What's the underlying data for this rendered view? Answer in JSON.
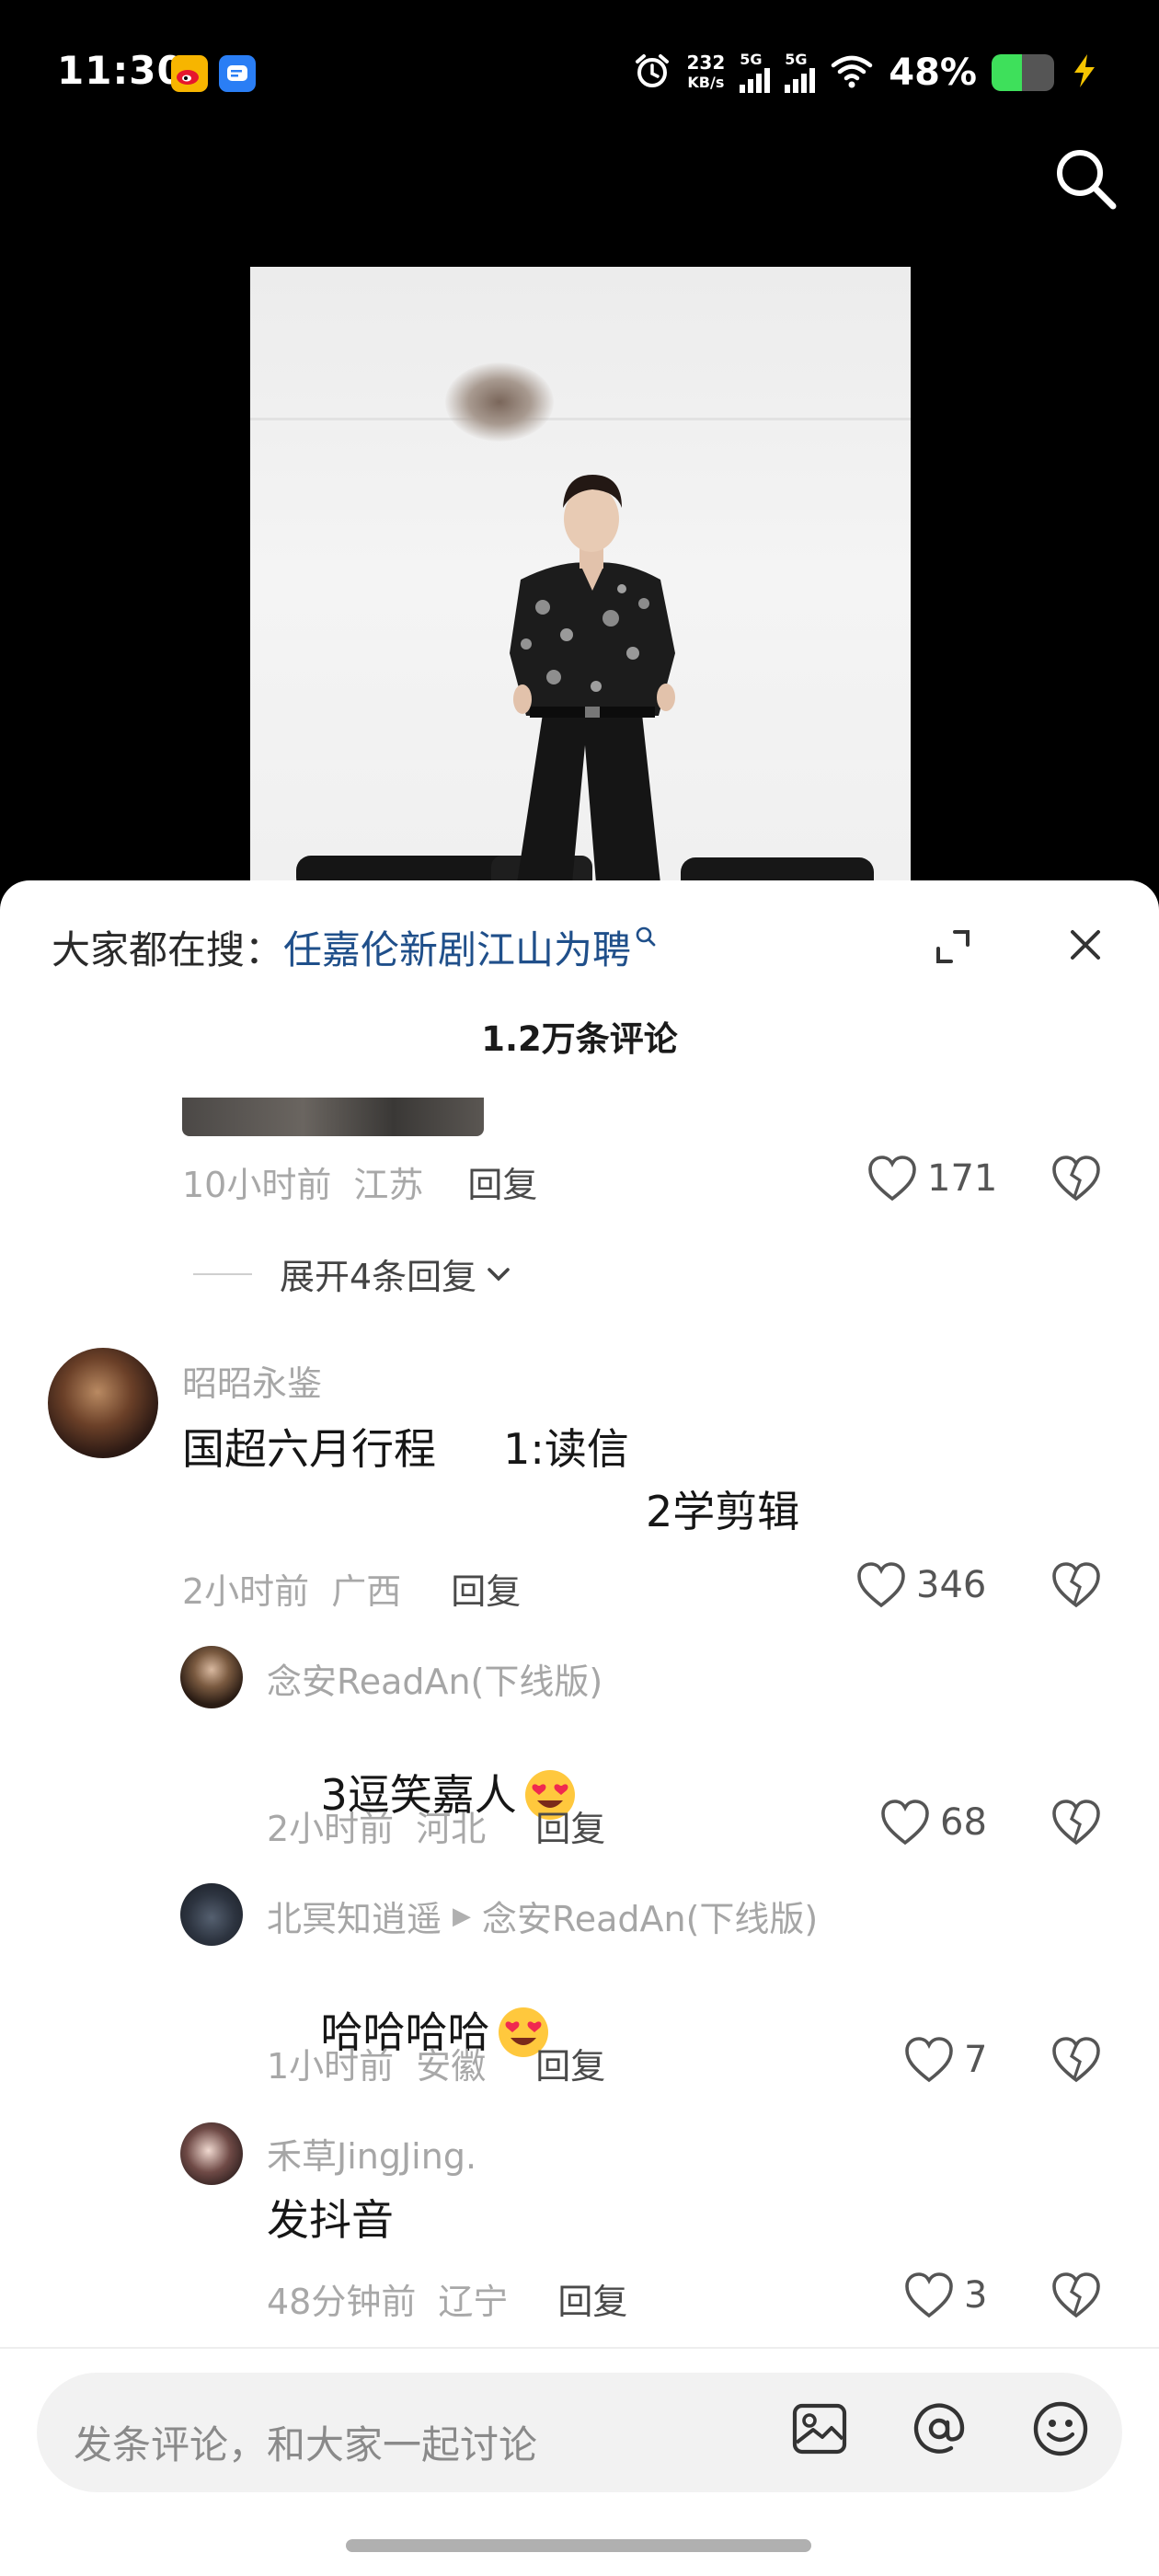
{
  "status_bar": {
    "time": "11:30",
    "net_speed_value": "232",
    "net_speed_unit": "KB/s",
    "sim1_label": "5G",
    "sim2_label": "5G",
    "battery_text": "48%",
    "battery_level": 0.48,
    "icons": [
      "weibo-icon",
      "message-app-icon",
      "alarm-icon",
      "wifi-icon",
      "battery-icon",
      "charging-icon"
    ]
  },
  "top": {
    "search_icon": "search-icon"
  },
  "sheet": {
    "hot_search_prefix": "大家都在搜：",
    "hot_search_term": "任嘉伦新剧江山为聘",
    "comment_count": "1.2万条评论"
  },
  "prev_comment": {
    "time": "10小时前",
    "location": "江苏",
    "reply_label": "回复",
    "likes": "171",
    "expand_label": "展开4条回复"
  },
  "main_comment": {
    "username": "昭昭永鉴",
    "text_line1": "国超六月行程     1:读信",
    "text_line2": "2学剪辑",
    "time": "2小时前",
    "location": "广西",
    "reply_label": "回复",
    "likes": "346"
  },
  "replies": [
    {
      "username": "念安ReadAn(下线版)",
      "text": "3逗笑嘉人",
      "time": "2小时前",
      "location": "河北",
      "reply_label": "回复",
      "likes": "68"
    },
    {
      "username": "北冥知逍遥",
      "reply_to": "念安ReadAn(下线版)",
      "text": "哈哈哈哈",
      "time": "1小时前",
      "location": "安徽",
      "reply_label": "回复",
      "likes": "7"
    },
    {
      "username": "禾草JingJing.",
      "text": "发抖音",
      "time": "48分钟前",
      "location": "辽宁",
      "reply_label": "回复",
      "likes": "3"
    }
  ],
  "input": {
    "placeholder": "发条评论，和大家一起讨论",
    "icons": [
      "image-icon",
      "at-icon",
      "emoji-icon"
    ]
  },
  "colors": {
    "accent_link": "#1f4f8a",
    "battery_green": "#3ee05b",
    "sheet_bg": "#ffffff",
    "page_bg": "#000000"
  }
}
